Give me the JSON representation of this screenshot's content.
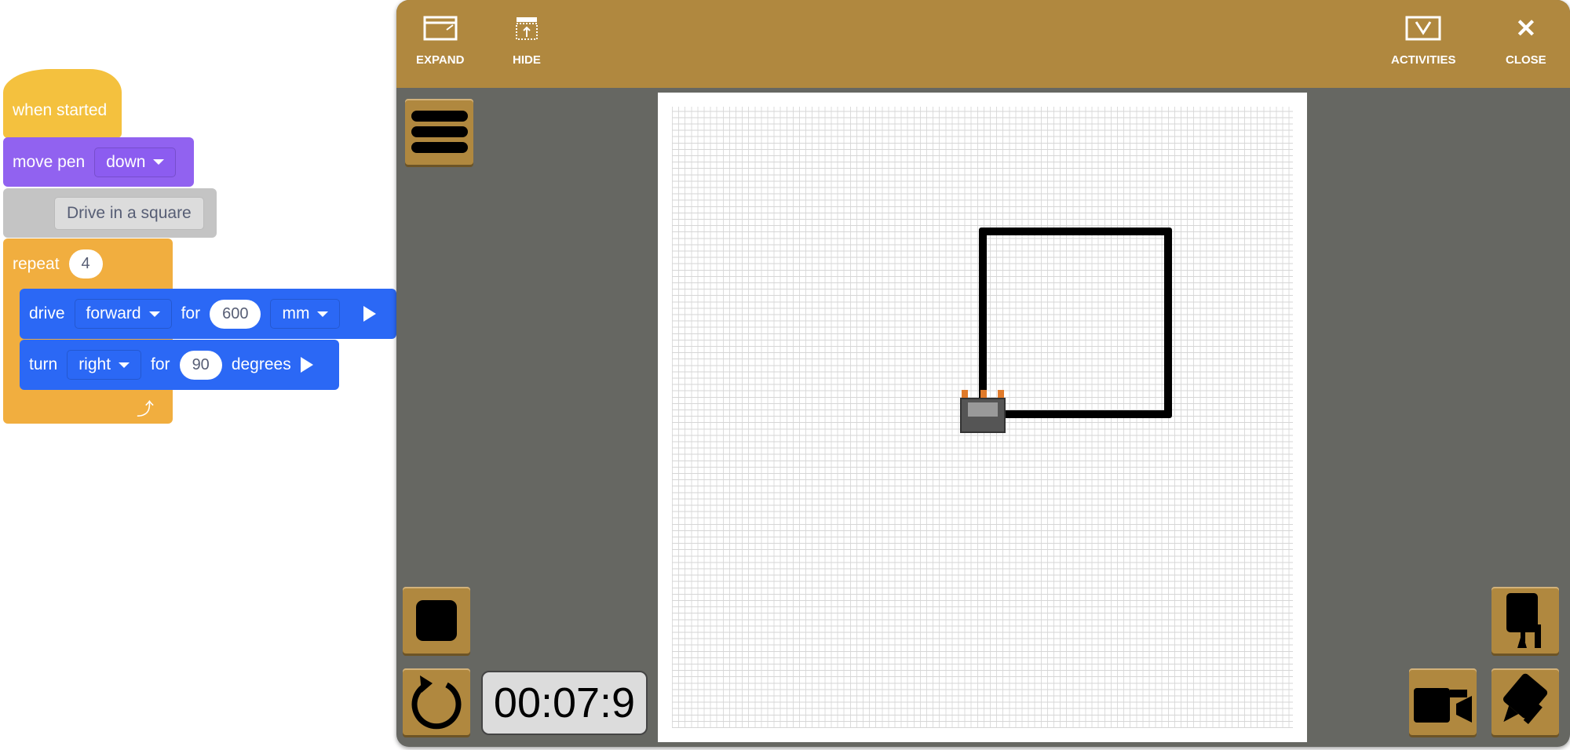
{
  "blocks": {
    "when_started": "when started",
    "move_pen": {
      "label": "move pen",
      "value": "down"
    },
    "comment": "Drive in a square",
    "repeat": {
      "label": "repeat",
      "count": "4"
    },
    "drive": {
      "label": "drive",
      "direction": "forward",
      "for": "for",
      "distance": "600",
      "unit": "mm"
    },
    "turn": {
      "label": "turn",
      "direction": "right",
      "for": "for",
      "angle": "90",
      "unit": "degrees"
    }
  },
  "header": {
    "expand": "EXPAND",
    "hide": "HIDE",
    "activities": "ACTIVITIES",
    "close": "CLOSE"
  },
  "timer": "00:07:9",
  "colors": {
    "header": "#b0883f",
    "panel": "#666762",
    "events": "#f4c13e",
    "looks": "#9162f0",
    "control": "#f1ae3f",
    "motion": "#2b68f5"
  }
}
